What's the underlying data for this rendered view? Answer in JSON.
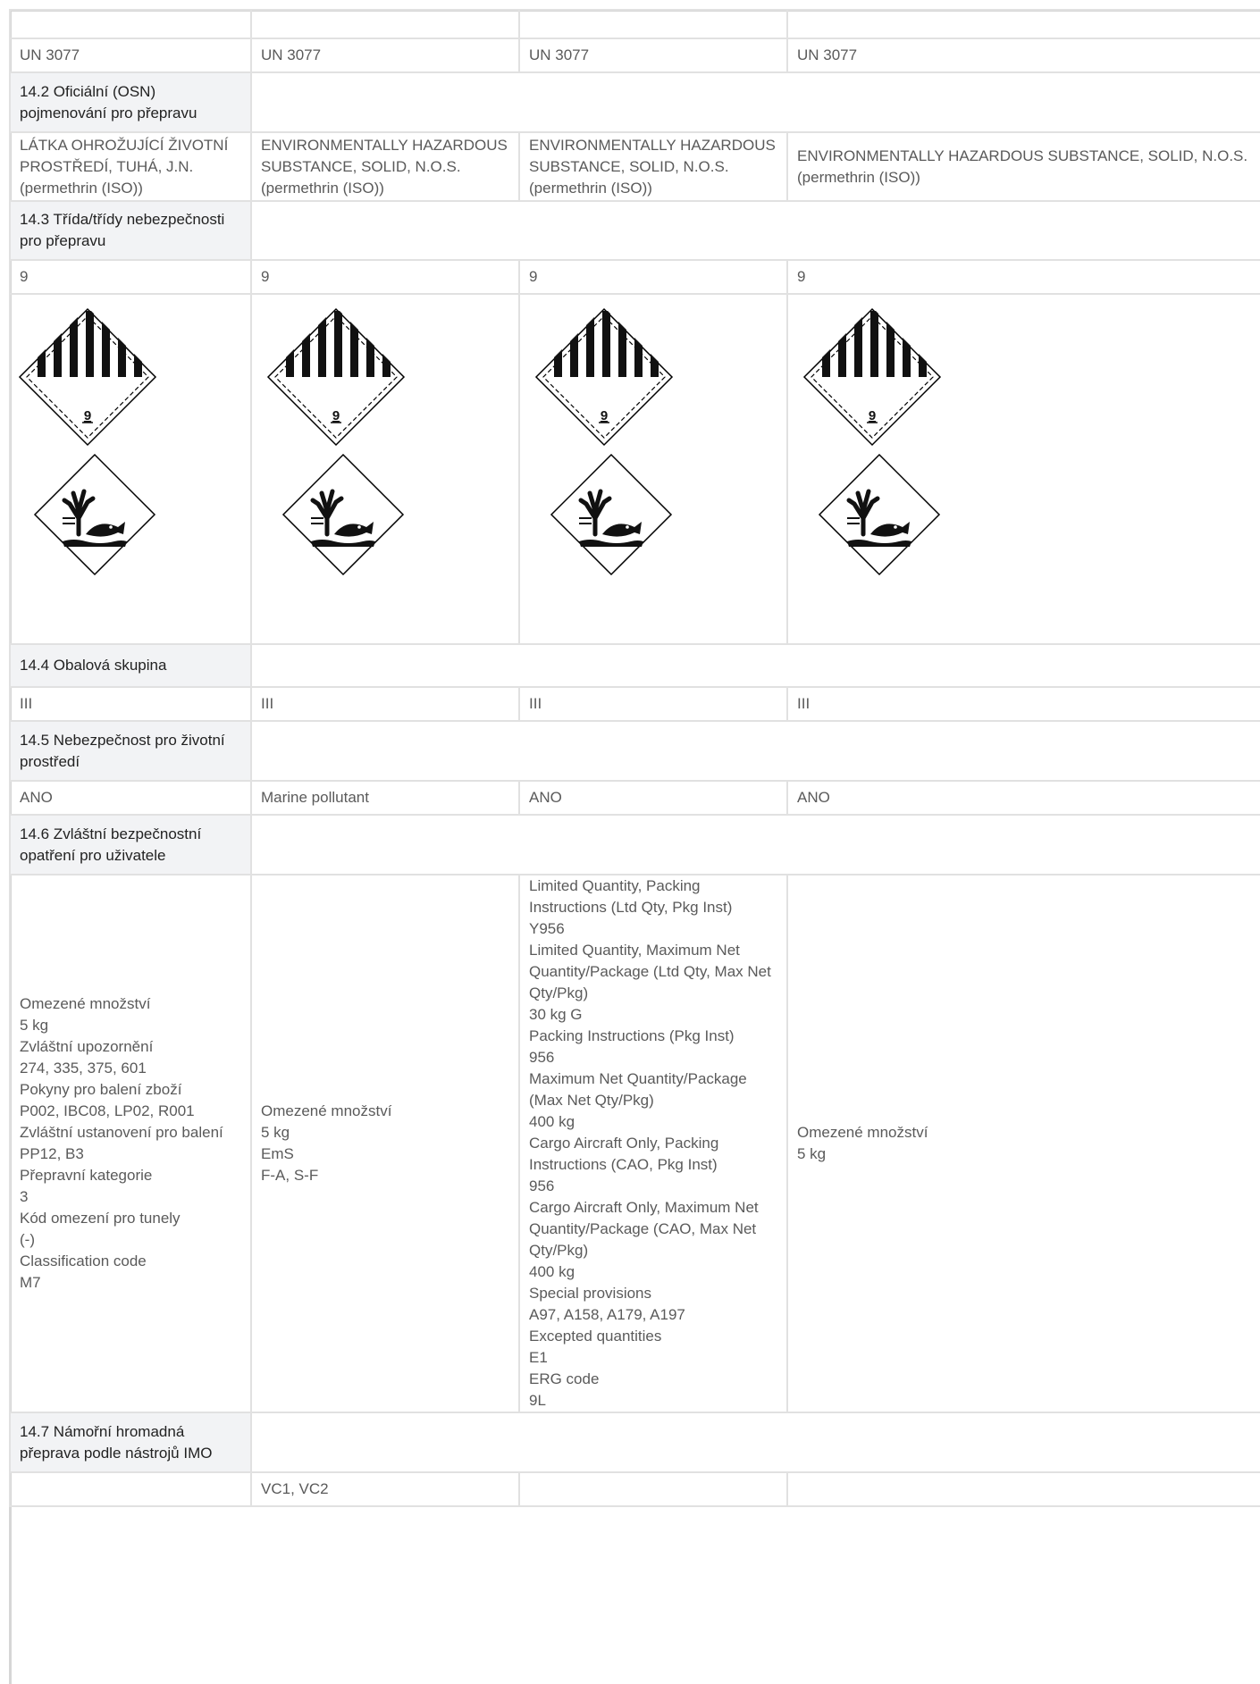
{
  "section": {
    "un_number": [
      "UN 3077",
      "UN 3077",
      "UN 3077",
      "UN 3077"
    ],
    "shipping_name_heading": "14.2 Oficiální (OSN) pojmenování pro přepravu",
    "shipping_names": [
      "LÁTKA OHROŽUJÍCÍ ŽIVOTNÍ PROSTŘEDÍ, TUHÁ, J.N.\n(permethrin (ISO))",
      "ENVIRONMENTALLY HAZARDOUS SUBSTANCE, SOLID, N.O.S.\n(permethrin (ISO))",
      "ENVIRONMENTALLY HAZARDOUS SUBSTANCE, SOLID, N.O.S.\n(permethrin (ISO))",
      "ENVIRONMENTALLY HAZARDOUS SUBSTANCE, SOLID, N.O.S.\n(permethrin (ISO))"
    ],
    "hazard_class_heading": "14.3 Třída/třídy nebezpečnosti pro přepravu",
    "hazard_classes": [
      "9",
      "9",
      "9",
      "9"
    ],
    "pictogram_class_label": "9",
    "packing_group_heading": "14.4 Obalová skupina",
    "packing_groups": [
      "III",
      "III",
      "III",
      "III"
    ],
    "env_hazard_heading": "14.5 Nebezpečnost pro životní prostředí",
    "env_hazards": [
      "ANO",
      "Marine pollutant",
      "ANO",
      "ANO"
    ],
    "special_precautions_heading": "14.6 Zvláštní bezpečnostní opatření pro uživatele",
    "special_precautions": [
      "Omezené množství\n5 kg\nZvláštní upozornění\n274, 335, 375, 601\nPokyny pro balení zboží\nP002, IBC08, LP02, R001\nZvláštní ustanovení pro balení\nPP12, B3\nPřepravní kategorie\n3\nKód omezení pro tunely\n(-)\nClassification code\nM7",
      "Omezené množství\n5 kg\nEmS\nF-A, S-F",
      "Limited Quantity, Packing Instructions (Ltd Qty, Pkg Inst)\nY956\nLimited Quantity, Maximum Net Quantity/Package (Ltd Qty, Max Net Qty/Pkg)\n30 kg G\nPacking Instructions (Pkg Inst)\n956\nMaximum Net Quantity/Package (Max Net Qty/Pkg)\n400 kg\nCargo Aircraft Only, Packing Instructions (CAO, Pkg Inst)\n956\nCargo Aircraft Only, Maximum Net Quantity/Package (CAO, Max Net Qty/Pkg)\n400 kg\nSpecial provisions\nA97, A158, A179, A197\nExcepted quantities\nE1\nERG code\n9L",
      "Omezené množství\n5 kg"
    ],
    "imo_heading": "14.7 Námořní hromadná přeprava podle nástrojů IMO",
    "imo_values": [
      "",
      "VC1, VC2",
      "",
      ""
    ]
  },
  "icons": {
    "class9": "class-9-hazard-diamond-icon",
    "environment": "environment-hazard-icon"
  }
}
